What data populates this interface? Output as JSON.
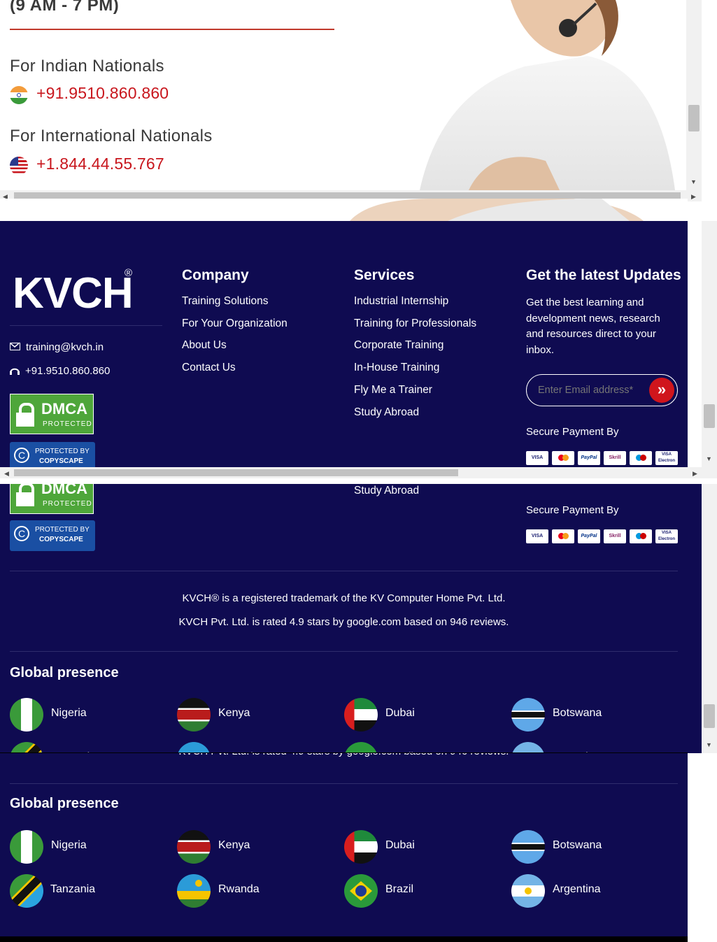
{
  "contact": {
    "hours_text": "(9 AM - 7 PM)",
    "indian_heading": "For Indian Nationals",
    "indian_phone": "+91.9510.860.860",
    "intl_heading": "For International Nationals",
    "intl_phone": "+1.844.44.55.767"
  },
  "footer": {
    "logo_text": "KVCH",
    "logo_mark": "®",
    "email": "training@kvch.in",
    "phone": "+91.9510.860.860",
    "dmca_label": "DMCA",
    "dmca_sub": "PROTECTED",
    "copyscape_top": "PROTECTED BY",
    "copyscape_bottom": "COPYSCAPE",
    "company": {
      "title": "Company",
      "links": [
        "Training Solutions",
        "For Your Organization",
        "About Us",
        "Contact Us"
      ]
    },
    "services": {
      "title": "Services",
      "links": [
        "Industrial Internship",
        "Training for Professionals",
        "Corporate Training",
        "In-House Training",
        "Fly Me a Trainer",
        "Study Abroad"
      ]
    },
    "updates": {
      "title": "Get the latest Updates",
      "description": "Get the best learning and development news, research and resources direct to your inbox.",
      "email_placeholder": "Enter Email address*",
      "submit_glyph": "»",
      "secure_payment": "Secure Payment By",
      "payment_methods": [
        "VISA",
        "MC",
        "PayPal",
        "Skrill",
        "Maestro",
        "VISA Electron"
      ]
    },
    "trademark": "KVCH® is a registered trademark of the KV Computer Home Pvt. Ltd.",
    "rating": "KVCH Pvt. Ltd. is rated 4.9 stars by google.com based on 946 reviews.",
    "global_title": "Global presence",
    "countries_row1": [
      "Nigeria",
      "Kenya",
      "Dubai",
      "Botswana"
    ],
    "countries_row2": [
      "Tanzania",
      "Rwanda",
      "Brazil",
      "Argentina"
    ]
  },
  "colors": {
    "navy": "#0f0b51",
    "brand_red": "#c8161d",
    "dmca_green": "#4ea63a",
    "copyscape_blue": "#1a4fa3"
  },
  "icons": [
    "mail-icon",
    "headset-icon",
    "india-flag-icon",
    "usa-flag-icon",
    "double-chevron-right-icon"
  ]
}
